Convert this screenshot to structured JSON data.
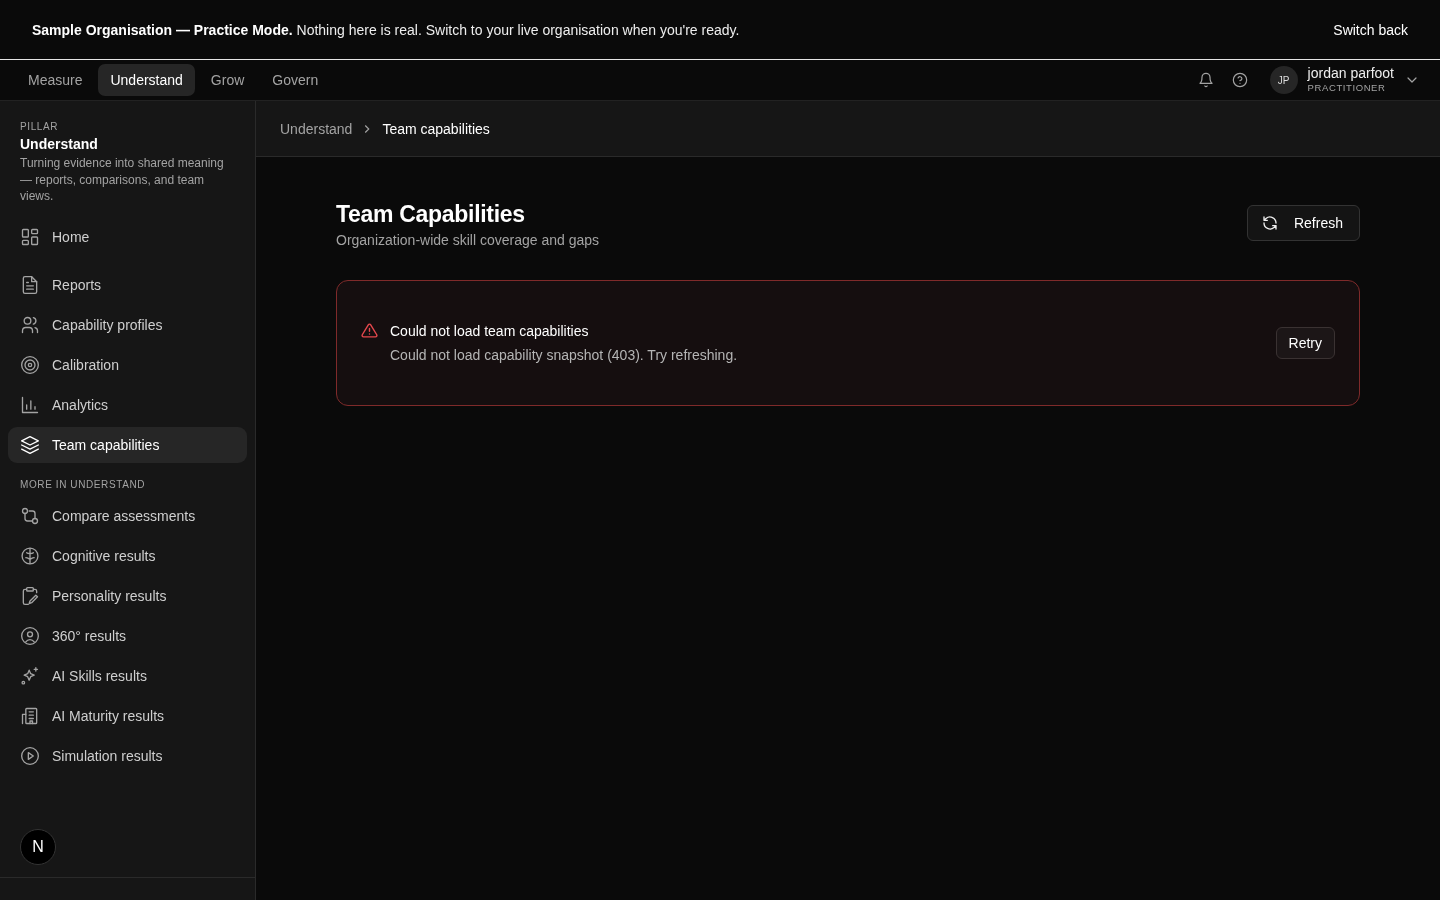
{
  "banner": {
    "text": "**Sample Organisation — Practice Mode.** Nothing here is real. Switch to your live organisation when you're ready.",
    "action": "Switch back"
  },
  "tabs": [
    {
      "label": "Measure",
      "selected": false
    },
    {
      "label": "Understand",
      "selected": true
    },
    {
      "label": "Grow",
      "selected": false
    },
    {
      "label": "Govern",
      "selected": false
    }
  ],
  "user": {
    "initials": "JP",
    "name": "jordan parfoot",
    "role": "PRACTITIONER"
  },
  "sidebar": {
    "eyebrow": "PILLAR",
    "title": "Understand",
    "description": "Turning evidence into shared meaning — reports, comparisons, and team views.",
    "home": {
      "label": "Home",
      "selected": false
    },
    "items": [
      {
        "label": "Reports",
        "selected": false
      },
      {
        "label": "Capability profiles",
        "selected": false
      },
      {
        "label": "Calibration",
        "selected": false
      },
      {
        "label": "Analytics",
        "selected": false
      },
      {
        "label": "Team capabilities",
        "selected": true
      }
    ],
    "more_heading": "MORE IN UNDERSTAND",
    "more_items": [
      {
        "label": "Compare assessments",
        "selected": false
      },
      {
        "label": "Cognitive results",
        "selected": false
      },
      {
        "label": "Personality results",
        "selected": false
      },
      {
        "label": "360° results",
        "selected": false
      },
      {
        "label": "AI Skills results",
        "selected": false
      },
      {
        "label": "AI Maturity results",
        "selected": false
      },
      {
        "label": "Simulation results",
        "selected": false
      }
    ],
    "badge": "N"
  },
  "breadcrumb": [
    "Understand",
    "Team capabilities"
  ],
  "page": {
    "title": "Team Capabilities",
    "subtitle": "Organization-wide skill coverage and gaps",
    "refresh": "Refresh"
  },
  "error": {
    "title": "Could not load team capabilities",
    "message": "Could not load capability snapshot (403). Try refreshing.",
    "retry": "Retry"
  }
}
